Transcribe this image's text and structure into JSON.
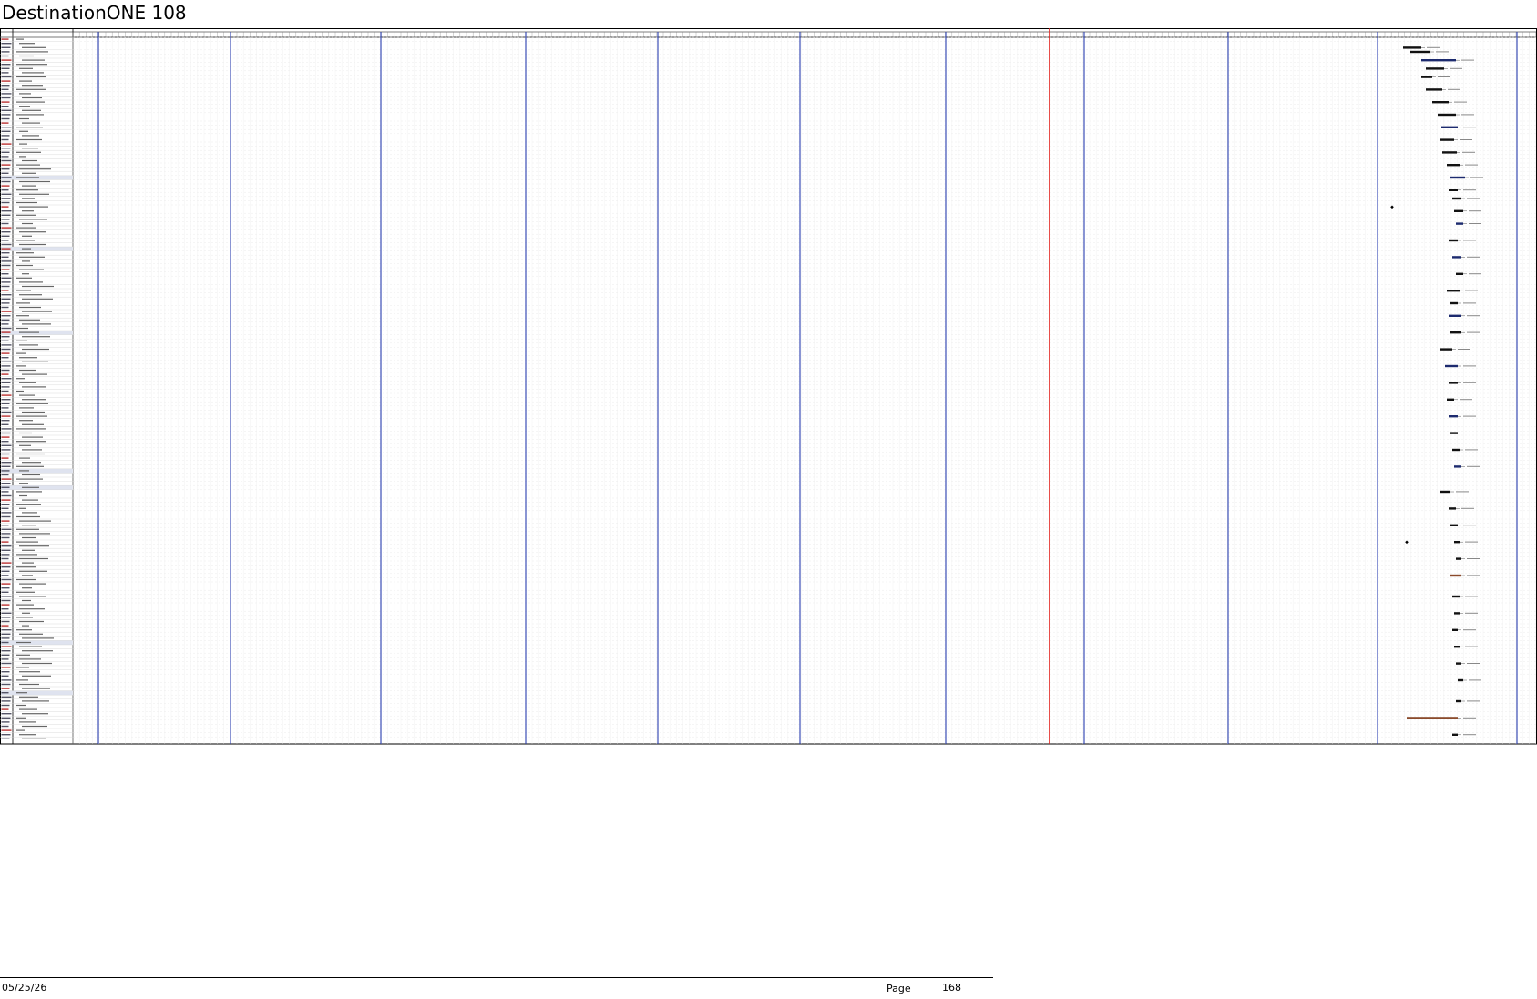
{
  "document": {
    "title": "DestinationONE 108",
    "footer_date": "05/25/26",
    "footer_page_label": "Page",
    "footer_page_number": "168"
  },
  "colors": {
    "grid_line": "#d2d2d2",
    "minor_dash": "#e4e4e4",
    "period_separator": "#2b3fb0",
    "status_date_line": "#e3211c",
    "bar_dark": "#1c2a6e",
    "bar_black": "#111111",
    "bar_brown": "#8a4a2b",
    "summary_row_fill": "#dfe3ef"
  },
  "legend_note": "Gantt task rows are too small to read; labels rendered as illegible marks."
}
